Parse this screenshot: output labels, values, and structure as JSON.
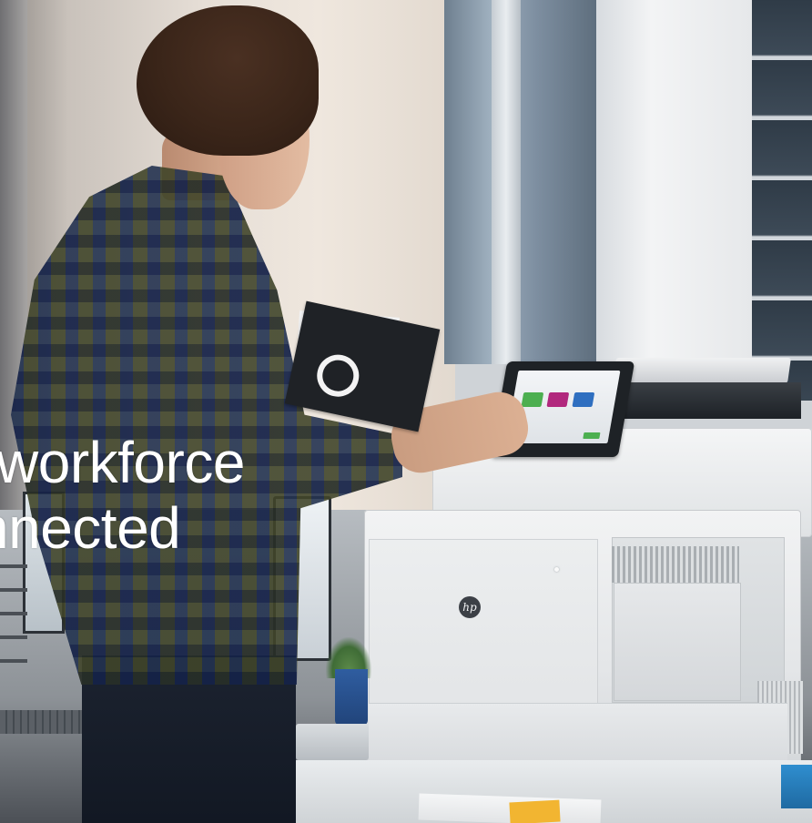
{
  "headline": {
    "line1": "workforce",
    "line2": "nnected"
  },
  "printer": {
    "brand_logo": "hp",
    "screen_tiles": [
      "green",
      "magenta",
      "blue"
    ]
  },
  "colors": {
    "headline_text": "#ffffff",
    "tile_green": "#4caf50",
    "tile_magenta": "#b1287d",
    "tile_blue": "#2f6fc0",
    "post_it": "#f2b531"
  }
}
